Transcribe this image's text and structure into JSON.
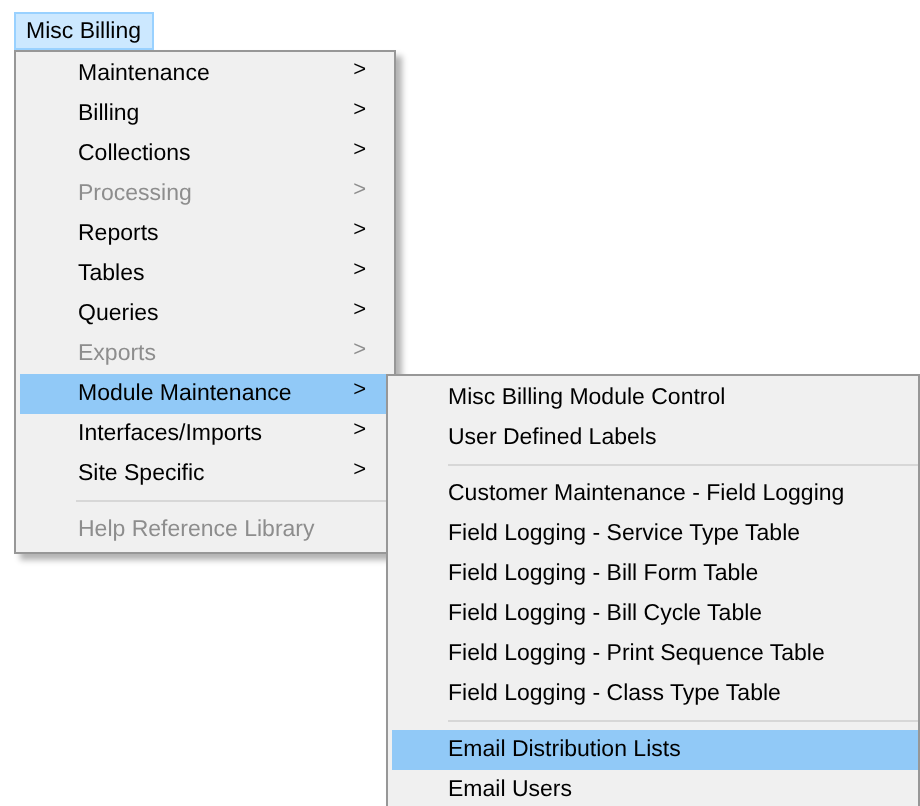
{
  "menu_bar": [
    {
      "label": "Misc Billing",
      "selected": true
    }
  ],
  "menu": {
    "items": [
      {
        "kind": "item",
        "label": "Maintenance",
        "arrow": ">",
        "disabled": false,
        "selected": false
      },
      {
        "kind": "item",
        "label": "Billing",
        "arrow": ">",
        "disabled": false,
        "selected": false
      },
      {
        "kind": "item",
        "label": "Collections",
        "arrow": ">",
        "disabled": false,
        "selected": false
      },
      {
        "kind": "item",
        "label": "Processing",
        "arrow": ">",
        "disabled": true,
        "selected": false
      },
      {
        "kind": "item",
        "label": "Reports",
        "arrow": ">",
        "disabled": false,
        "selected": false
      },
      {
        "kind": "item",
        "label": "Tables",
        "arrow": ">",
        "disabled": false,
        "selected": false
      },
      {
        "kind": "item",
        "label": "Queries",
        "arrow": ">",
        "disabled": false,
        "selected": false
      },
      {
        "kind": "item",
        "label": "Exports",
        "arrow": ">",
        "disabled": true,
        "selected": false
      },
      {
        "kind": "item",
        "label": "Module Maintenance",
        "arrow": ">",
        "disabled": false,
        "selected": true
      },
      {
        "kind": "item",
        "label": "Interfaces/Imports",
        "arrow": ">",
        "disabled": false,
        "selected": false
      },
      {
        "kind": "item",
        "label": "Site Specific",
        "arrow": ">",
        "disabled": false,
        "selected": false
      },
      {
        "kind": "separator"
      },
      {
        "kind": "item",
        "label": "Help Reference Library",
        "disabled": true,
        "selected": false
      }
    ]
  },
  "submenu": {
    "items": [
      {
        "kind": "item",
        "label": "Misc Billing Module Control",
        "disabled": false,
        "selected": false
      },
      {
        "kind": "item",
        "label": "User Defined Labels",
        "disabled": false,
        "selected": false
      },
      {
        "kind": "separator"
      },
      {
        "kind": "item",
        "label": "Customer Maintenance - Field Logging",
        "disabled": false,
        "selected": false
      },
      {
        "kind": "item",
        "label": "Field Logging - Service Type Table",
        "disabled": false,
        "selected": false
      },
      {
        "kind": "item",
        "label": "Field Logging - Bill Form Table",
        "disabled": false,
        "selected": false
      },
      {
        "kind": "item",
        "label": "Field Logging - Bill Cycle Table",
        "disabled": false,
        "selected": false
      },
      {
        "kind": "item",
        "label": "Field Logging - Print Sequence Table",
        "disabled": false,
        "selected": false
      },
      {
        "kind": "item",
        "label": "Field Logging - Class Type Table",
        "disabled": false,
        "selected": false
      },
      {
        "kind": "separator"
      },
      {
        "kind": "item",
        "label": "Email Distribution Lists",
        "disabled": false,
        "selected": true
      },
      {
        "kind": "item",
        "label": "Email Users",
        "disabled": false,
        "selected": false
      }
    ]
  }
}
